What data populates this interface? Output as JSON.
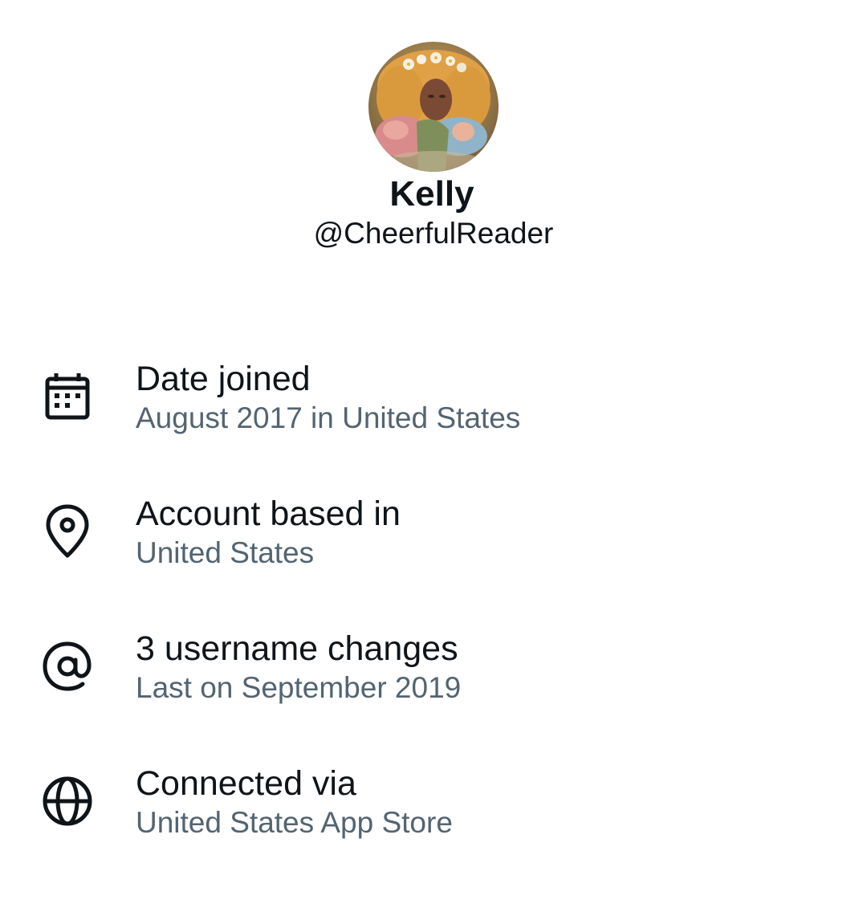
{
  "profile": {
    "display_name": "Kelly",
    "handle": "@CheerfulReader",
    "avatar_icon": "profile-photo"
  },
  "colors": {
    "primary_text": "#0f1419",
    "secondary_text": "#536471",
    "icon": "#0f1419"
  },
  "info": [
    {
      "icon": "calendar-icon",
      "title": "Date joined",
      "subtitle": "August 2017 in United States"
    },
    {
      "icon": "location-pin-icon",
      "title": "Account based in",
      "subtitle": "United States"
    },
    {
      "icon": "at-sign-icon",
      "title": "3 username changes",
      "subtitle": "Last on September 2019"
    },
    {
      "icon": "globe-icon",
      "title": "Connected via",
      "subtitle": "United States App Store"
    }
  ]
}
